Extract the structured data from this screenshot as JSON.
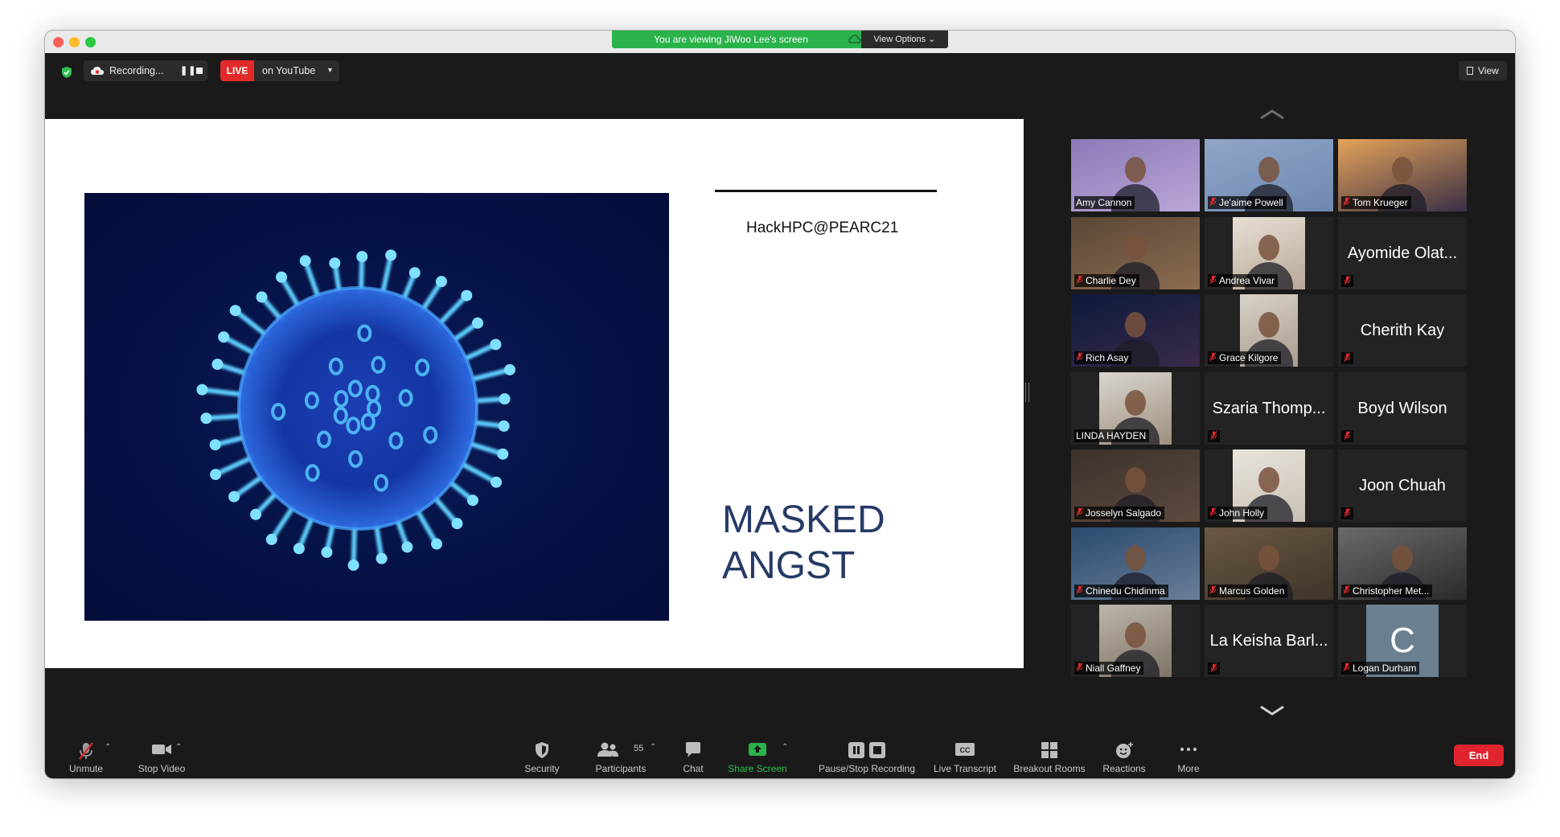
{
  "banner": {
    "text": "You are viewing JiWoo Lee's screen",
    "options": "View Options"
  },
  "meeting_bar": {
    "recording_label": "Recording...",
    "live_badge": "LIVE",
    "live_target": "on YouTube",
    "view_label": "View"
  },
  "slide": {
    "header": "HackHPC@PEARC21",
    "title_line1": "MASKED",
    "title_line2": "ANGST"
  },
  "gallery": {
    "participants": [
      {
        "name": "Amy Cannon",
        "video": true,
        "active": true
      },
      {
        "name": "Je'aime Powell",
        "video": true
      },
      {
        "name": "Tom Krueger",
        "video": true
      },
      {
        "name": "Charlie Dey",
        "video": true
      },
      {
        "name": "Andrea Vivar",
        "video": true
      },
      {
        "name": "Ayomide Olat...",
        "video": false
      },
      {
        "name": "Rich Asay",
        "video": true
      },
      {
        "name": "Grace Kilgore",
        "video": true
      },
      {
        "name": "Cherith Kay",
        "video": false
      },
      {
        "name": "LINDA HAYDEN",
        "video": true
      },
      {
        "name": "Szaria Thomp...",
        "video": false
      },
      {
        "name": "Boyd Wilson",
        "video": false
      },
      {
        "name": "Josselyn Salgado",
        "video": true
      },
      {
        "name": "John Holly",
        "video": true
      },
      {
        "name": "Joon Chuah",
        "video": false
      },
      {
        "name": "Chinedu Chidinma",
        "video": true
      },
      {
        "name": "Marcus Golden",
        "video": true
      },
      {
        "name": "Christopher Met...",
        "video": true
      },
      {
        "name": "Niall Gaffney",
        "video": true
      },
      {
        "name": "La Keisha Barl...",
        "video": false
      },
      {
        "name": "Logan Durham",
        "video": true,
        "avatar_letter": "C"
      }
    ]
  },
  "toolbar": {
    "unmute": "Unmute",
    "stop_video": "Stop Video",
    "security": "Security",
    "participants": "Participants",
    "participant_count": "55",
    "chat": "Chat",
    "share_screen": "Share Screen",
    "pause_stop_recording": "Pause/Stop Recording",
    "live_transcript": "Live Transcript",
    "breakout_rooms": "Breakout Rooms",
    "reactions": "Reactions",
    "more": "More",
    "end": "End"
  },
  "colors": {
    "share_green": "#29b34a",
    "live_red": "#e32a2a",
    "end_red": "#e0242e",
    "active_speaker": "#c5d928",
    "slide_title": "#263a66"
  }
}
